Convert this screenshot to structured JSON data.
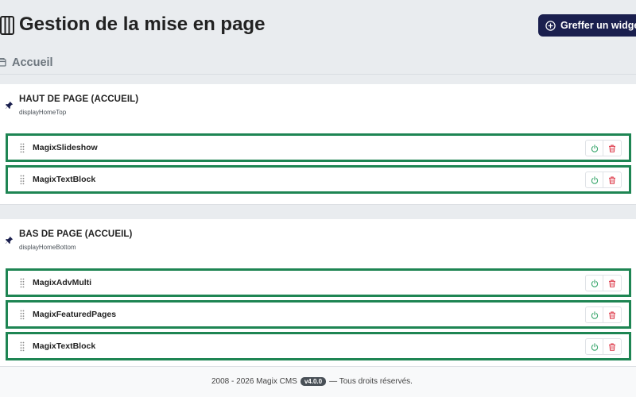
{
  "header": {
    "title": "Gestion de la mise en page",
    "add_widget_label": "Greffer un widget",
    "title_icon": "columns-icon",
    "add_icon": "plus-circle-icon"
  },
  "subheader": {
    "title": "Accueil",
    "icon": "home-window-icon"
  },
  "hooks": [
    {
      "title": "HAUT DE PAGE (ACCUEIL)",
      "code": "displayHomeTop",
      "icon": "pin-icon",
      "widgets": [
        {
          "name": "MagixSlideshow"
        },
        {
          "name": "MagixTextBlock"
        }
      ]
    },
    {
      "title": "BAS DE PAGE (ACCUEIL)",
      "code": "displayHomeBottom",
      "icon": "pin-icon",
      "widgets": [
        {
          "name": "MagixAdvMulti"
        },
        {
          "name": "MagixFeaturedPages"
        },
        {
          "name": "MagixTextBlock"
        }
      ]
    }
  ],
  "footer": {
    "text_before": "2008 - 2026 Magix CMS",
    "version": "v4.0.0",
    "text_after": "— Tous droits réservés."
  },
  "colors": {
    "primary_button": "#1a1f4e",
    "widget_border": "#1e8553",
    "toggle_icon": "#3aa76d",
    "delete_icon": "#dc3545"
  }
}
